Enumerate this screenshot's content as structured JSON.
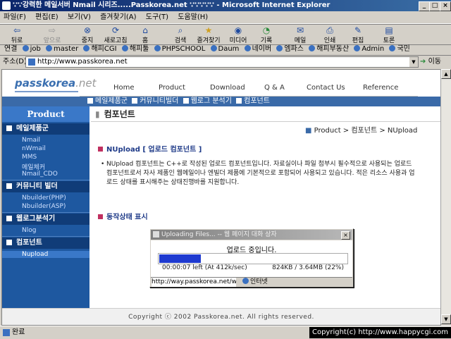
{
  "window": {
    "title": "∵∵강력한 메일서버 Nmail 시리즈.....Passkorea.net ∵∵∵∵∵ - Microsoft Internet Explorer"
  },
  "menu": [
    "파일(F)",
    "편집(E)",
    "보기(V)",
    "즐겨찾기(A)",
    "도구(T)",
    "도움말(H)"
  ],
  "toolbar": {
    "back": "뒤로",
    "forward": "앞으로",
    "stop": "중지",
    "refresh": "새로고침",
    "home": "홈",
    "search": "검색",
    "favorites": "즐겨찾기",
    "media": "미디어",
    "history": "기록",
    "mail": "메일",
    "print": "인쇄",
    "edit": "편집",
    "discuss": "토론"
  },
  "links": {
    "label": "연결",
    "items": [
      "job",
      "master",
      "해피CGI",
      "해피툴",
      "PHPSCHOOL",
      "Daum",
      "네이버",
      "엠파스",
      "해피부동산",
      "Admin",
      "국민"
    ]
  },
  "address": {
    "label": "주소(D)",
    "url": "http://www.passkorea.net",
    "go": "이동",
    "links_label": "연결"
  },
  "site": {
    "logo_main": "passkorea",
    "logo_ext": ".net",
    "nav": [
      "Home",
      "Product",
      "Download",
      "Q & A",
      "Contact Us",
      "Reference"
    ],
    "subnav": [
      "메일제품군",
      "커뮤니티빌더",
      "웹로그 분석기",
      "컴포넌트"
    ],
    "sidebar": {
      "title": "Product",
      "sections": [
        {
          "label": "메일제품군",
          "items": [
            "Nmail",
            "nWmail",
            "MMS",
            "메일체커",
            "Nmail_CDO"
          ]
        },
        {
          "label": "커뮤니티 빌더",
          "items": [
            "Nbuilder(PHP)",
            "Nbuilder(ASP)"
          ]
        },
        {
          "label": "웹로그분석기",
          "items": [
            "Nlog"
          ]
        },
        {
          "label": "컴포넌트",
          "items": [
            "Nupload"
          ]
        }
      ]
    },
    "page_title": "컴포넌트",
    "breadcrumb": "Product > 컴포넌트 > NUpload",
    "section1": "NUpload [ 업로드 컴포넌트 ]",
    "paragraph": "NUpload 컴포넌트는 C++로 작성된 업로드 컴포넌트입니다. 자료실이나 파일 첨부시 필수적으로 사용되는 업로드 컴포넌트로서 자사 제품인 웹메일이나 엔빌더 제품에 기본적으로 포함되어 사용되고 있습니다. 적은 리소스 사용과 업로드 상태를 표시해주는 상태진행바를 지원합니다.",
    "section2": "동작상태 표시",
    "footer": "Copyright ⓒ 2002 Passkorea.net. All rights reserved."
  },
  "dialog": {
    "title": "Uploading Files... -- 웹 페이지 대화 상자",
    "status": "업로드 중입니다.",
    "progress": 0.22,
    "time_left": "00:00:07 left (At 412k/sec)",
    "transfer": "824KB / 3.64MB (22%)",
    "url": "http://way.passkorea.net/w",
    "zone": "인터넷"
  },
  "statusbar": {
    "text": "완료",
    "copyright": "Copyright(c) http://www.happycgi.com"
  },
  "colors": {
    "titlebar": "#0a246a",
    "sidebar": "#1e58a0",
    "progress": "#1e3ad0"
  }
}
